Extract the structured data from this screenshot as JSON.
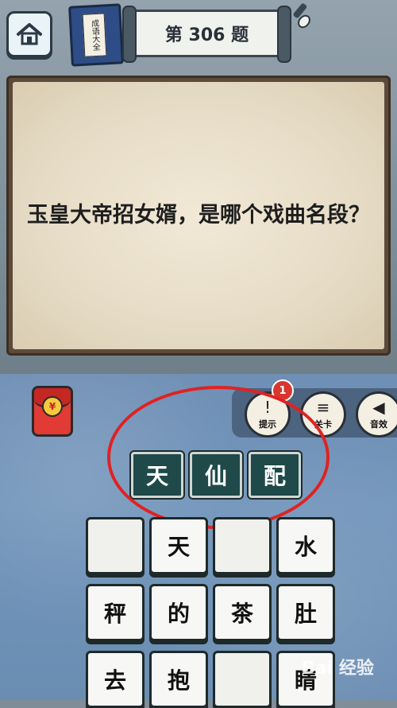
{
  "header": {
    "level_title": "第 306 题",
    "book_label": "成语大全"
  },
  "question": {
    "text": "玉皇大帝招女婿，是哪个戏曲名段？"
  },
  "tools": [
    {
      "label": "提示",
      "icon": "bulb-icon",
      "badge": "1"
    },
    {
      "label": "关卡",
      "icon": "list-icon"
    },
    {
      "label": "音效",
      "icon": "speaker-icon"
    }
  ],
  "answer": {
    "slots": [
      "天",
      "仙",
      "配"
    ]
  },
  "candidates": [
    {
      "char": "",
      "state": "used"
    },
    {
      "char": "天",
      "state": "available"
    },
    {
      "char": "",
      "state": "used"
    },
    {
      "char": "水",
      "state": "available"
    },
    {
      "char": "秤",
      "state": "available"
    },
    {
      "char": "的",
      "state": "available"
    },
    {
      "char": "茶",
      "state": "available"
    },
    {
      "char": "肚",
      "state": "available"
    },
    {
      "char": "去",
      "state": "available"
    },
    {
      "char": "抱",
      "state": "available"
    },
    {
      "char": "",
      "state": "used"
    },
    {
      "char": "睛",
      "state": "available"
    }
  ],
  "watermark": "Bai 经验",
  "colors": {
    "answer_slot_bg": "#1f4a49",
    "highlight_ring": "#e02222",
    "badge": "#d9362e"
  }
}
